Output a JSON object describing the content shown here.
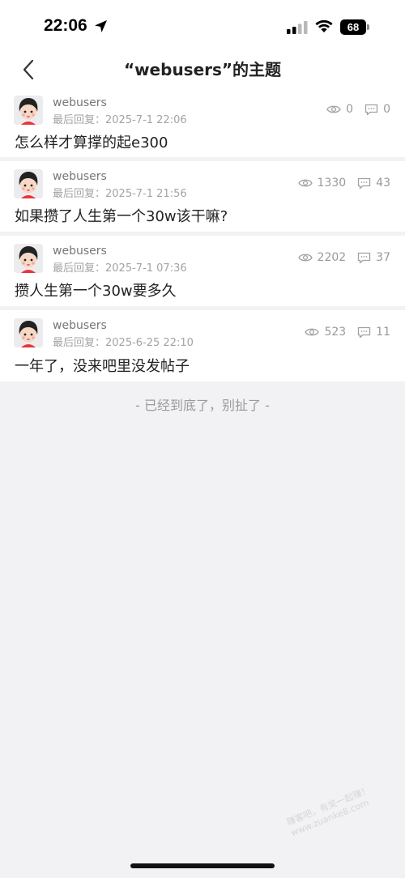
{
  "status_bar": {
    "time": "22:06",
    "battery": "68",
    "icons": [
      "location-arrow-icon",
      "cellular-signal-icon",
      "wifi-icon",
      "battery-icon"
    ]
  },
  "nav": {
    "title": "“webusers”的主题",
    "back_icon": "chevron-left-icon"
  },
  "posts": [
    {
      "user": "webusers",
      "reply_label": "最后回复：",
      "reply_time": "2025-7-1 22:06",
      "views": "0",
      "comments": "0",
      "title": "怎么样才算撑的起e300"
    },
    {
      "user": "webusers",
      "reply_label": "最后回复：",
      "reply_time": "2025-7-1 21:56",
      "views": "1330",
      "comments": "43",
      "title": "如果攒了人生第一个30w该干嘛?"
    },
    {
      "user": "webusers",
      "reply_label": "最后回复：",
      "reply_time": "2025-7-1 07:36",
      "views": "2202",
      "comments": "37",
      "title": "攒人生第一个30w要多久"
    },
    {
      "user": "webusers",
      "reply_label": "最后回复：",
      "reply_time": "2025-6-25 22:10",
      "views": "523",
      "comments": "11",
      "title": "一年了，没来吧里没发帖子"
    }
  ],
  "end_note": "- 已经到底了，别扯了 -",
  "watermark": {
    "line1": "赚客吧，有奖一起赚！",
    "line2": "www.zuanke8.com"
  }
}
